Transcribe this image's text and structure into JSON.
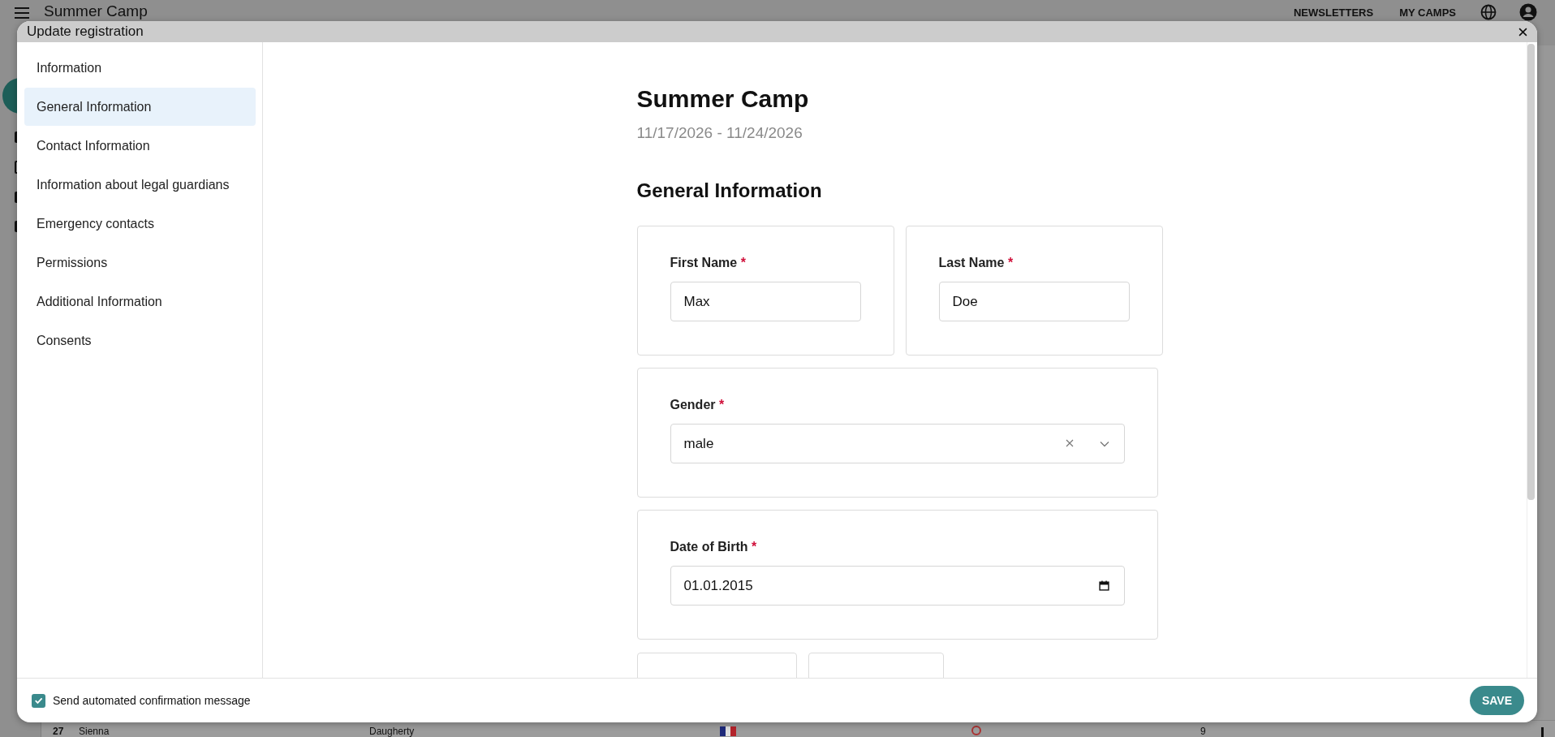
{
  "background": {
    "app_title": "Summer Camp",
    "nav": [
      "NEWSLETTERS",
      "MY CAMPS"
    ],
    "row": {
      "number": "27",
      "first_name": "Sienna",
      "last_name": "Daugherty",
      "column_4": "9"
    }
  },
  "dialog": {
    "title": "Update registration",
    "sidebar": [
      {
        "label": "Information",
        "selected": false
      },
      {
        "label": "General Information",
        "selected": true
      },
      {
        "label": "Contact Information",
        "selected": false
      },
      {
        "label": "Information about legal guardians",
        "selected": false
      },
      {
        "label": "Emergency contacts",
        "selected": false
      },
      {
        "label": "Permissions",
        "selected": false
      },
      {
        "label": "Additional Information",
        "selected": false
      },
      {
        "label": "Consents",
        "selected": false
      }
    ],
    "event": {
      "title": "Summer Camp",
      "dates": "11/17/2026 - 11/24/2026"
    },
    "section_title": "General Information",
    "rows": [
      [
        {
          "kind": "text",
          "label": "First Name",
          "required_mark": "*",
          "value": "Max"
        },
        {
          "kind": "text",
          "label": "Last Name",
          "required_mark": "*",
          "value": "Doe"
        }
      ],
      [
        {
          "kind": "select",
          "label": "Gender",
          "required_mark": "*",
          "value": "male"
        }
      ],
      [
        {
          "kind": "date",
          "label": "Date of Birth",
          "required_mark": "*",
          "value": "01.01.2015"
        }
      ],
      [
        {
          "kind": "blank"
        },
        {
          "kind": "blank"
        }
      ]
    ],
    "footer": {
      "send_confirmation": {
        "label": "Send automated confirmation message",
        "checked": true
      },
      "save_label": "SAVE"
    }
  }
}
